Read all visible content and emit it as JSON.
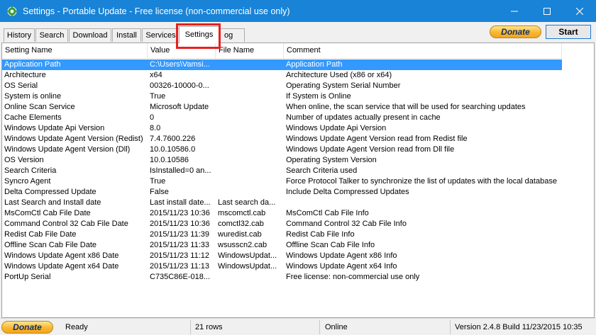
{
  "window": {
    "title": "Settings - Portable Update  - Free license (non-commercial use only)"
  },
  "tabs": [
    {
      "label": "History"
    },
    {
      "label": "Search"
    },
    {
      "label": "Download"
    },
    {
      "label": "Install"
    },
    {
      "label": "Services"
    },
    {
      "label": "Settings"
    },
    {
      "label": "Log"
    }
  ],
  "tabs_visible": {
    "log_label": "og"
  },
  "toolbar": {
    "donate_label": "Donate",
    "start_label": "Start"
  },
  "grid": {
    "columns": [
      "Setting Name",
      "Value",
      "File Name",
      "Comment"
    ],
    "rows": [
      [
        "Application Path",
        "C:\\Users\\Vamsi...",
        "",
        "Application Path"
      ],
      [
        "Architecture",
        "x64",
        "",
        "Architecture Used (x86 or x64)"
      ],
      [
        "OS Serial",
        "00326-10000-0...",
        "",
        "Operating System Serial Number"
      ],
      [
        "System is online",
        "True",
        "",
        "If System is Online"
      ],
      [
        "Online Scan Service",
        "Microsoft Update",
        "",
        "When online, the scan service that will be used for searching updates"
      ],
      [
        "Cache Elements",
        "0",
        "",
        "Number of updates actually present in cache"
      ],
      [
        "Windows Update Api Version",
        "8.0",
        "",
        "Windows Update Api Version"
      ],
      [
        "Windows Update Agent Version (Redist)",
        "7.4.7600.226",
        "",
        "Windows Update Agent Version read from Redist file"
      ],
      [
        "Windows Update Agent Version (Dll)",
        "10.0.10586.0",
        "",
        "Windows Update Agent Version read from Dll file"
      ],
      [
        "OS Version",
        "10.0.10586",
        "",
        "Operating System Version"
      ],
      [
        "Search Criteria",
        "IsInstalled=0 an...",
        "",
        "Search Criteria used"
      ],
      [
        "Syncro Agent",
        "True",
        "",
        "Force Protocol Talker to synchronize the list of updates with the local database"
      ],
      [
        "Delta Compressed Update",
        "False",
        "",
        "Include Delta Compressed Updates"
      ],
      [
        "Last Search and Install date",
        "Last install date...",
        "Last search da...",
        ""
      ],
      [
        "MsComCtl Cab File Date",
        "2015/11/23 10:36",
        "mscomctl.cab",
        "MsComCtl Cab File Info"
      ],
      [
        "Command Control 32 Cab File Date",
        "2015/11/23 10:36",
        "comctl32.cab",
        "Command Control 32 Cab File Info"
      ],
      [
        "Redist Cab File Date",
        "2015/11/23 11:39",
        "wuredist.cab",
        "Redist Cab File Info"
      ],
      [
        "Offline Scan Cab File Date",
        "2015/11/23 11:33",
        "wsusscn2.cab",
        "Offline Scan Cab File Info"
      ],
      [
        "Windows Update Agent x86 Date",
        "2015/11/23 11:12",
        "WindowsUpdat...",
        "Windows Update Agent x86 Info"
      ],
      [
        "Windows Update Agent x64 Date",
        "2015/11/23 11:13",
        "WindowsUpdat...",
        "Windows Update Agent x64 Info"
      ],
      [
        "PortUp Serial",
        "C735C86E-018...",
        "",
        "Free license: non-commercial use only"
      ]
    ]
  },
  "statusbar": {
    "donate_label": "Donate",
    "status": "Ready",
    "rows": "21 rows",
    "connection": "Online",
    "version": "Version 2.4.8 Build 11/23/2015 10:35"
  },
  "colors": {
    "titlebar": "#1883d7",
    "selection": "#3399ff",
    "highlight_box": "#e8201e",
    "donate": "#f7b733"
  }
}
